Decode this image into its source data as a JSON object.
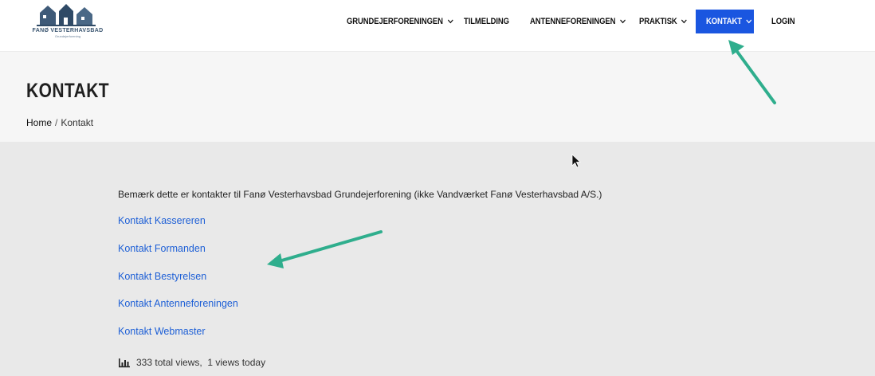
{
  "logo": {
    "name": "FANØ VESTERHAVSBAD",
    "subtitle": "Grundejerforening",
    "icon": "houses-logo-icon"
  },
  "nav": {
    "items": [
      {
        "label": "GRUNDEJERFORENINGEN",
        "has_dropdown": true
      },
      {
        "label": "TILMELDING",
        "has_dropdown": false
      },
      {
        "label": "ANTENNEFORENINGEN",
        "has_dropdown": true
      },
      {
        "label": "PRAKTISK",
        "has_dropdown": true
      },
      {
        "label": "KONTAKT",
        "has_dropdown": true,
        "active": true
      },
      {
        "label": "LOGIN",
        "has_dropdown": false
      }
    ],
    "active_color": "#1a56e0"
  },
  "page": {
    "title": "KONTAKT",
    "breadcrumb": {
      "home": "Home",
      "separator": "/",
      "current": "Kontakt"
    }
  },
  "content": {
    "notice": "Bemærk dette er kontakter til Fanø Vesterhavsbad Grundejerforening (ikke Vandværket Fanø Vesterhavsbad A/S.)",
    "links": [
      "Kontakt Kassereren",
      "Kontakt Formanden",
      "Kontakt Bestyrelsen",
      "Kontakt Antenneforeningen",
      "Kontakt Webmaster"
    ],
    "views": {
      "icon": "bar-chart-icon",
      "text": "333 total views,  1 views today"
    }
  },
  "colors": {
    "link": "#1d5fd6",
    "annotation_arrow": "#2fae8d",
    "title_band": "#f6f6f6",
    "content_bg": "#e9e9e9"
  }
}
